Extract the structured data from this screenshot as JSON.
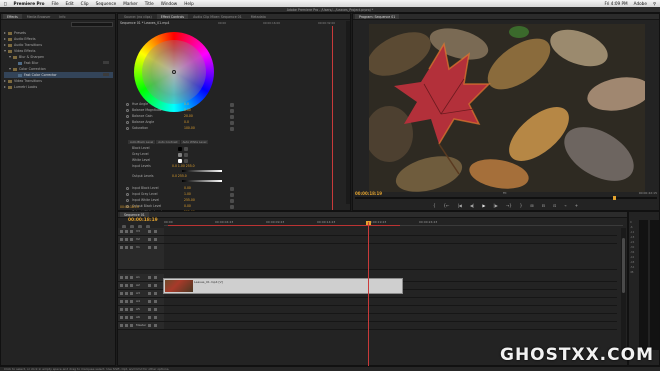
{
  "menubar": {
    "app_name": "Premiere Pro",
    "items": [
      "File",
      "Edit",
      "Clip",
      "Sequence",
      "Marker",
      "Title",
      "Window",
      "Help"
    ],
    "clock": "Fri 4:09 PM",
    "user": "Adobe"
  },
  "window_title": "Adobe Premiere Pro - /Users/.../Leaves_Project.prproj *",
  "effects_panel": {
    "tabs": [
      "Effects",
      "Media Browser",
      "Info"
    ],
    "tree": [
      {
        "label": "Presets",
        "kind": "folder",
        "open": false
      },
      {
        "label": "Audio Effects",
        "kind": "folder",
        "open": false
      },
      {
        "label": "Audio Transitions",
        "kind": "folder",
        "open": false
      },
      {
        "label": "Video Effects",
        "kind": "folder",
        "open": true
      },
      {
        "label": "Blur & Sharpen",
        "kind": "folder",
        "open": true,
        "indent": 1
      },
      {
        "label": "Fast Blur",
        "kind": "fx",
        "indent": 2
      },
      {
        "label": "Color Correction",
        "kind": "folder",
        "open": true,
        "indent": 1
      },
      {
        "label": "Fast Color Corrector",
        "kind": "fx",
        "indent": 2,
        "selected": true
      },
      {
        "label": "Video Transitions",
        "kind": "folder",
        "open": false
      },
      {
        "label": "Lumetri Looks",
        "kind": "folder",
        "open": false
      }
    ]
  },
  "effect_controls": {
    "tabs": [
      "Source: (no clips)",
      "Effect Controls",
      "Audio Clip Mixer: Sequence 01",
      "Metadata"
    ],
    "clip_name": "Sequence 01 * Leaves_01.mp4",
    "ruler": [
      "00:00",
      "00:00:16:00",
      "00:00:32:00"
    ],
    "params_top": [
      {
        "name": "Hue Angle",
        "value": "0.0"
      },
      {
        "name": "Balance Magnitude",
        "value": "0.00"
      },
      {
        "name": "Balance Gain",
        "value": "20.00"
      },
      {
        "name": "Balance Angle",
        "value": "0.0"
      },
      {
        "name": "Saturation",
        "value": "100.00"
      }
    ],
    "segments": [
      "Auto Black Level",
      "Auto Contrast",
      "Auto White Level"
    ],
    "levels": [
      {
        "name": "Black Level"
      },
      {
        "name": "Gray Level"
      },
      {
        "name": "White Level"
      }
    ],
    "input_levels": {
      "name": "Input Levels",
      "values": "0.0   1.00   255.0"
    },
    "output_levels": {
      "name": "Output Levels",
      "values": "0.0   255.0"
    },
    "params_bottom": [
      {
        "name": "Input Black Level",
        "value": "0.00"
      },
      {
        "name": "Input Gray Level",
        "value": "1.00"
      },
      {
        "name": "Input White Level",
        "value": "255.00"
      },
      {
        "name": "Output Black Level",
        "value": "0.00"
      },
      {
        "name": "Output White Level",
        "value": "255.00"
      }
    ],
    "timecode": "00:00:18:19"
  },
  "program": {
    "tab": "Program: Sequence 01",
    "timecode": "00:00:18:19",
    "fit": "Fit",
    "quality": "Full",
    "duration": "00:00:22:15",
    "scrub_fraction": 0.86,
    "transport": [
      "{",
      "{←",
      "|◀",
      "◀|",
      "▶",
      "|▶",
      "→}",
      "}",
      "⊞",
      "⊟",
      "⊡",
      "⌁",
      "+"
    ]
  },
  "timeline": {
    "tabs": [
      "Sequence 01"
    ],
    "timecode": "00:00:18:19",
    "ruler": [
      "00:00",
      "00:00:04:23",
      "00:00:09:23",
      "00:00:14:23",
      "00:00:19:23",
      "00:00:24:23"
    ],
    "video_tracks": [
      "V3",
      "V2",
      "V1"
    ],
    "audio_tracks": [
      "A1",
      "A2",
      "A3",
      "A4",
      "A5",
      "A6",
      "Master"
    ],
    "clip": {
      "name": "Leaves_01.mp4 [V]"
    },
    "playhead_fraction": 0.5
  },
  "meters": {
    "scale": [
      "0",
      "-6",
      "-12",
      "-18",
      "-24",
      "-30",
      "-36",
      "-42",
      "-48",
      "-54",
      "dB"
    ]
  },
  "status_bar": "Click to select, or click in empty space and drag to marquee select. Use Shift, Opt, and Cmd for other options.",
  "watermark": "GHOSTXX.COM",
  "colors": {
    "accent_timecode": "#e2a22e",
    "playhead": "#c83a3a",
    "selection": "#334459"
  }
}
